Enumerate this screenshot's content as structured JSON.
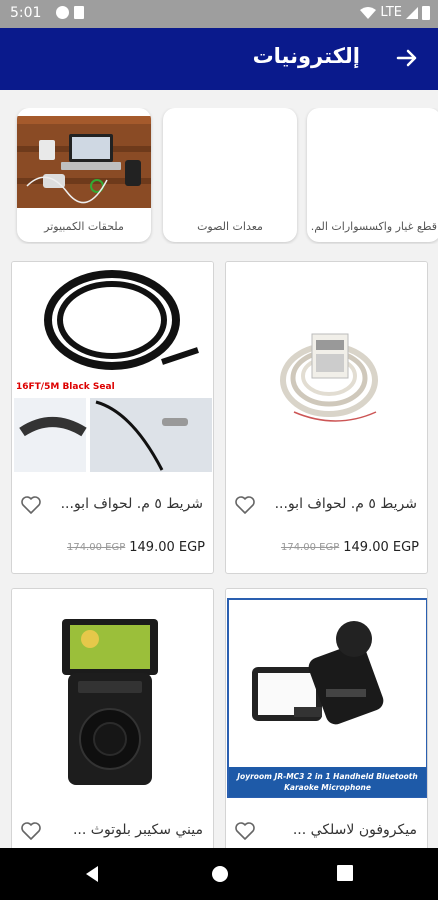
{
  "status_bar": {
    "time": "5:01",
    "network": "LTE"
  },
  "header": {
    "title": "إلكترونيات"
  },
  "categories": [
    {
      "label": "ملحقات الكمبيوتر"
    },
    {
      "label": "معدات الصوت"
    },
    {
      "label": "قطع غيار واكسسوارات الم..."
    }
  ],
  "products": [
    {
      "name": "شريط ٥ م. لحواف ابو...",
      "price": "149.00 EGP",
      "old_price": "174.00 EGP"
    },
    {
      "name": "شريط ٥ م. لحواف ابو...",
      "price": "149.00 EGP",
      "old_price": "174.00 EGP",
      "image_caption": "16FT/5M Black Seal"
    },
    {
      "name": "ميكروفون لاسلكي ...",
      "image_caption": "Joyroom JR-MC3 2 in 1 Handheld Bluetooth Karaoke Microphone"
    },
    {
      "name": "ميني سكيبر بلوتوث ..."
    }
  ],
  "colors": {
    "app_bar": "#0a1a8c",
    "background": "#f2f2f2"
  }
}
